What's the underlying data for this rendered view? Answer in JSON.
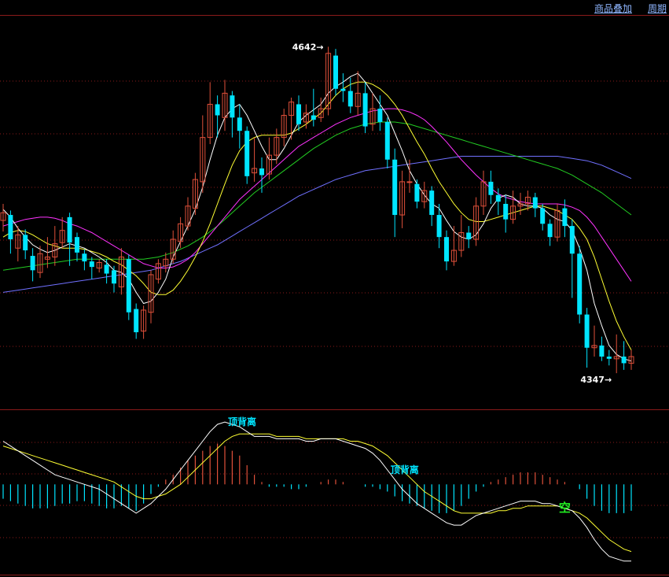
{
  "toolbar": {
    "overlay_label": "商品叠加",
    "period_label": "周期"
  },
  "colors": {
    "background": "#000000",
    "grid": "#8a1a1a",
    "up": "#e0503a",
    "down": "#00e5ff",
    "ma5": "#ffffff",
    "ma10": "#ffff33",
    "ma20": "#ff33ff",
    "ma40": "#22cc22",
    "ma60": "#7070ff",
    "signal_text": "#22ee22",
    "divergence_text": "#00e5ff",
    "extreme_text": "#ffffff",
    "macd_up": "#e0503a",
    "macd_down": "#00e5ff"
  },
  "chart_data": {
    "type": "candlestick",
    "price_ylim": [
      4325,
      4670
    ],
    "extremes": {
      "high_label": "4642",
      "low_label": "4347"
    },
    "candles": [
      [
        4485,
        4492,
        4500,
        4475
      ],
      [
        4490,
        4468,
        4494,
        4455
      ],
      [
        4460,
        4472,
        4480,
        4448
      ],
      [
        4472,
        4458,
        4477,
        4450
      ],
      [
        4453,
        4440,
        4460,
        4430
      ],
      [
        4438,
        4455,
        4462,
        4433
      ],
      [
        4450,
        4452,
        4470,
        4442
      ],
      [
        4452,
        4464,
        4480,
        4444
      ],
      [
        4465,
        4476,
        4488,
        4460
      ],
      [
        4488,
        4465,
        4492,
        4444
      ],
      [
        4470,
        4456,
        4474,
        4448
      ],
      [
        4455,
        4448,
        4459,
        4440
      ],
      [
        4448,
        4443,
        4452,
        4432
      ],
      [
        4442,
        4447,
        4450,
        4438
      ],
      [
        4445,
        4437,
        4450,
        4428
      ],
      [
        4440,
        4428,
        4444,
        4420
      ],
      [
        4425,
        4452,
        4460,
        4418
      ],
      [
        4450,
        4402,
        4454,
        4395
      ],
      [
        4405,
        4384,
        4410,
        4378
      ],
      [
        4385,
        4404,
        4408,
        4378
      ],
      [
        4402,
        4436,
        4440,
        4392
      ],
      [
        4432,
        4446,
        4450,
        4428
      ],
      [
        4444,
        4450,
        4456,
        4438
      ],
      [
        4450,
        4468,
        4476,
        4446
      ],
      [
        4466,
        4482,
        4488,
        4460
      ],
      [
        4480,
        4498,
        4506,
        4476
      ],
      [
        4496,
        4522,
        4528,
        4490
      ],
      [
        4520,
        4560,
        4580,
        4510
      ],
      [
        4560,
        4590,
        4610,
        4554
      ],
      [
        4590,
        4580,
        4598,
        4560
      ],
      [
        4578,
        4600,
        4612,
        4566
      ],
      [
        4598,
        4578,
        4602,
        4560
      ],
      [
        4578,
        4566,
        4590,
        4550
      ],
      [
        4566,
        4525,
        4570,
        4518
      ],
      [
        4528,
        4532,
        4560,
        4520
      ],
      [
        4532,
        4526,
        4542,
        4510
      ],
      [
        4527,
        4544,
        4560,
        4522
      ],
      [
        4544,
        4560,
        4568,
        4536
      ],
      [
        4560,
        4580,
        4586,
        4552
      ],
      [
        4580,
        4592,
        4596,
        4558
      ],
      [
        4590,
        4572,
        4598,
        4566
      ],
      [
        4574,
        4582,
        4590,
        4568
      ],
      [
        4580,
        4576,
        4604,
        4570
      ],
      [
        4578,
        4586,
        4596,
        4574
      ],
      [
        4586,
        4636,
        4642,
        4580
      ],
      [
        4634,
        4604,
        4640,
        4598
      ],
      [
        4604,
        4602,
        4618,
        4592
      ],
      [
        4602,
        4588,
        4614,
        4582
      ],
      [
        4588,
        4600,
        4620,
        4580
      ],
      [
        4600,
        4570,
        4610,
        4564
      ],
      [
        4572,
        4586,
        4600,
        4566
      ],
      [
        4586,
        4574,
        4598,
        4566
      ],
      [
        4574,
        4540,
        4578,
        4532
      ],
      [
        4540,
        4490,
        4550,
        4470
      ],
      [
        4490,
        4520,
        4530,
        4478
      ],
      [
        4520,
        4520,
        4540,
        4510
      ],
      [
        4518,
        4502,
        4522,
        4496
      ],
      [
        4502,
        4512,
        4520,
        4496
      ],
      [
        4512,
        4490,
        4516,
        4480
      ],
      [
        4490,
        4470,
        4500,
        4460
      ],
      [
        4470,
        4448,
        4476,
        4440
      ],
      [
        4448,
        4458,
        4480,
        4444
      ],
      [
        4458,
        4474,
        4490,
        4452
      ],
      [
        4474,
        4468,
        4480,
        4460
      ],
      [
        4468,
        4498,
        4506,
        4462
      ],
      [
        4498,
        4520,
        4530,
        4490
      ],
      [
        4520,
        4508,
        4530,
        4500
      ],
      [
        4508,
        4502,
        4514,
        4490
      ],
      [
        4500,
        4486,
        4508,
        4474
      ],
      [
        4486,
        4498,
        4512,
        4482
      ],
      [
        4498,
        4500,
        4510,
        4490
      ],
      [
        4500,
        4506,
        4512,
        4494
      ],
      [
        4506,
        4496,
        4510,
        4488
      ],
      [
        4496,
        4482,
        4500,
        4476
      ],
      [
        4482,
        4470,
        4486,
        4462
      ],
      [
        4470,
        4494,
        4500,
        4466
      ],
      [
        4496,
        4480,
        4504,
        4470
      ],
      [
        4480,
        4455,
        4486,
        4415
      ],
      [
        4455,
        4400,
        4462,
        4392
      ],
      [
        4400,
        4370,
        4406,
        4352
      ],
      [
        4370,
        4372,
        4390,
        4362
      ],
      [
        4372,
        4362,
        4380,
        4358
      ],
      [
        4362,
        4360,
        4368,
        4354
      ],
      [
        4360,
        4362,
        4382,
        4347
      ],
      [
        4362,
        4356,
        4376,
        4350
      ],
      [
        4356,
        4362,
        4368,
        4350
      ]
    ],
    "ma5": [
      4495,
      4488,
      4478,
      4470,
      4463,
      4459,
      4456,
      4458,
      4461,
      4464,
      4462,
      4460,
      4456,
      4452,
      4447,
      4440,
      4438,
      4432,
      4420,
      4410,
      4412,
      4420,
      4432,
      4452,
      4466,
      4480,
      4495,
      4515,
      4540,
      4562,
      4578,
      4586,
      4590,
      4580,
      4566,
      4552,
      4540,
      4540,
      4550,
      4562,
      4574,
      4580,
      4585,
      4590,
      4600,
      4606,
      4610,
      4615,
      4618,
      4610,
      4600,
      4590,
      4580,
      4564,
      4548,
      4530,
      4518,
      4508,
      4500,
      4496,
      4485,
      4475,
      4470,
      4468,
      4472,
      4482,
      4496,
      4505,
      4508,
      4506,
      4500,
      4498,
      4498,
      4496,
      4490,
      4486,
      4484,
      4476,
      4460,
      4440,
      4410,
      4390,
      4372,
      4364,
      4360,
      4358
    ],
    "ma10": [
      4470,
      4474,
      4476,
      4475,
      4472,
      4468,
      4464,
      4462,
      4460,
      4460,
      4460,
      4459,
      4457,
      4455,
      4452,
      4448,
      4445,
      4440,
      4435,
      4428,
      4420,
      4418,
      4418,
      4422,
      4430,
      4440,
      4452,
      4466,
      4482,
      4500,
      4518,
      4535,
      4548,
      4556,
      4560,
      4562,
      4562,
      4562,
      4562,
      4564,
      4568,
      4572,
      4577,
      4582,
      4590,
      4598,
      4604,
      4608,
      4610,
      4610,
      4608,
      4604,
      4598,
      4590,
      4580,
      4568,
      4556,
      4545,
      4532,
      4520,
      4510,
      4500,
      4492,
      4486,
      4484,
      4484,
      4486,
      4488,
      4490,
      4492,
      4494,
      4496,
      4498,
      4498,
      4496,
      4494,
      4490,
      4486,
      4478,
      4468,
      4452,
      4432,
      4412,
      4394,
      4380,
      4368
    ],
    "ma20": [
      4480,
      4482,
      4484,
      4486,
      4487,
      4488,
      4488,
      4487,
      4485,
      4482,
      4480,
      4477,
      4474,
      4470,
      4466,
      4462,
      4458,
      4454,
      4450,
      4446,
      4444,
      4442,
      4442,
      4443,
      4446,
      4450,
      4456,
      4464,
      4472,
      4480,
      4488,
      4496,
      4504,
      4510,
      4516,
      4522,
      4528,
      4534,
      4540,
      4546,
      4552,
      4556,
      4560,
      4564,
      4568,
      4572,
      4575,
      4578,
      4580,
      4582,
      4584,
      4585,
      4586,
      4586,
      4585,
      4583,
      4580,
      4576,
      4570,
      4563,
      4556,
      4548,
      4540,
      4533,
      4526,
      4520,
      4514,
      4509,
      4506,
      4504,
      4502,
      4501,
      4500,
      4500,
      4500,
      4500,
      4499,
      4497,
      4494,
      4488,
      4480,
      4470,
      4460,
      4450,
      4440,
      4430
    ],
    "ma40": [
      4440,
      4441,
      4442,
      4443,
      4444,
      4445,
      4446,
      4447,
      4448,
      4449,
      4450,
      4450,
      4450,
      4450,
      4450,
      4450,
      4450,
      4450,
      4450,
      4450,
      4451,
      4452,
      4454,
      4456,
      4459,
      4462,
      4466,
      4470,
      4475,
      4480,
      4486,
      4492,
      4498,
      4504,
      4510,
      4515,
      4520,
      4525,
      4530,
      4535,
      4540,
      4545,
      4550,
      4554,
      4558,
      4562,
      4565,
      4568,
      4570,
      4572,
      4573,
      4574,
      4574,
      4574,
      4573,
      4572,
      4570,
      4568,
      4566,
      4564,
      4562,
      4560,
      4558,
      4556,
      4554,
      4552,
      4550,
      4548,
      4546,
      4544,
      4542,
      4540,
      4538,
      4536,
      4534,
      4532,
      4529,
      4526,
      4522,
      4518,
      4514,
      4510,
      4505,
      4500,
      4495,
      4490
    ],
    "ma60": [
      4420,
      4421,
      4422,
      4423,
      4424,
      4425,
      4426,
      4427,
      4428,
      4429,
      4430,
      4431,
      4432,
      4433,
      4434,
      4435,
      4436,
      4437,
      4438,
      4439,
      4440,
      4442,
      4444,
      4446,
      4448,
      4451,
      4454,
      4457,
      4460,
      4463,
      4467,
      4471,
      4475,
      4479,
      4483,
      4487,
      4491,
      4495,
      4499,
      4503,
      4507,
      4510,
      4513,
      4516,
      4519,
      4522,
      4524,
      4526,
      4528,
      4530,
      4531,
      4532,
      4533,
      4534,
      4535,
      4536,
      4537,
      4538,
      4539,
      4540,
      4541,
      4542,
      4543,
      4543,
      4543,
      4543,
      4543,
      4543,
      4543,
      4543,
      4543,
      4543,
      4543,
      4543,
      4543,
      4543,
      4542,
      4541,
      4540,
      4539,
      4537,
      4535,
      4532,
      4529,
      4526,
      4523
    ],
    "macd_ylim": [
      -36,
      28
    ],
    "macd_bars": [
      -6,
      -7,
      -8,
      -9,
      -10,
      -10,
      -10,
      -9,
      -8,
      -8,
      -7,
      -7,
      -8,
      -9,
      -10,
      -10,
      -9,
      -10,
      -11,
      -8,
      -4,
      -1,
      2,
      4,
      7,
      10,
      12,
      14,
      16,
      17,
      16,
      14,
      12,
      8,
      4,
      1,
      -1,
      -1,
      -1,
      -2,
      -2,
      -1,
      0,
      1,
      2,
      2,
      1,
      0,
      0,
      -1,
      -1,
      -2,
      -3,
      -5,
      -7,
      -8,
      -9,
      -10,
      -11,
      -12,
      -12,
      -11,
      -9,
      -6,
      -3,
      -1,
      1,
      2,
      3,
      4,
      5,
      5,
      5,
      4,
      3,
      2,
      1,
      0,
      -2,
      -6,
      -9,
      -11,
      -12,
      -12,
      -12,
      -11
    ],
    "dif": [
      18,
      16,
      14,
      12,
      10,
      8,
      6,
      4,
      3,
      2,
      1,
      0,
      -1,
      -2,
      -4,
      -6,
      -8,
      -10,
      -12,
      -10,
      -8,
      -5,
      -2,
      2,
      6,
      10,
      14,
      18,
      22,
      25,
      26,
      25,
      24,
      22,
      20,
      20,
      20,
      19,
      19,
      19,
      19,
      18,
      18,
      19,
      19,
      19,
      18,
      17,
      16,
      15,
      13,
      10,
      6,
      2,
      -2,
      -5,
      -8,
      -10,
      -12,
      -14,
      -16,
      -17,
      -17,
      -15,
      -13,
      -12,
      -11,
      -10,
      -9,
      -8,
      -7,
      -7,
      -7,
      -8,
      -8,
      -9,
      -10,
      -11,
      -14,
      -18,
      -23,
      -27,
      -30,
      -31,
      -32,
      -32
    ],
    "dea": [
      16,
      15,
      14,
      13,
      12,
      11,
      10,
      9,
      8,
      7,
      6,
      5,
      4,
      3,
      2,
      1,
      -1,
      -3,
      -5,
      -6,
      -6,
      -5,
      -4,
      -2,
      0,
      3,
      6,
      9,
      12,
      15,
      18,
      20,
      21,
      21,
      21,
      21,
      21,
      20,
      20,
      20,
      20,
      19,
      19,
      19,
      19,
      19,
      19,
      18,
      18,
      17,
      16,
      14,
      12,
      9,
      6,
      3,
      0,
      -3,
      -5,
      -7,
      -9,
      -11,
      -12,
      -12,
      -12,
      -12,
      -12,
      -11,
      -11,
      -10,
      -10,
      -9,
      -9,
      -9,
      -9,
      -9,
      -10,
      -11,
      -12,
      -14,
      -17,
      -20,
      -23,
      -25,
      -27,
      -28
    ],
    "annotations": [
      {
        "label": "顶背离",
        "index": 30
      },
      {
        "label": "顶背离",
        "index": 52
      },
      {
        "label": "空",
        "index": 76
      }
    ]
  }
}
